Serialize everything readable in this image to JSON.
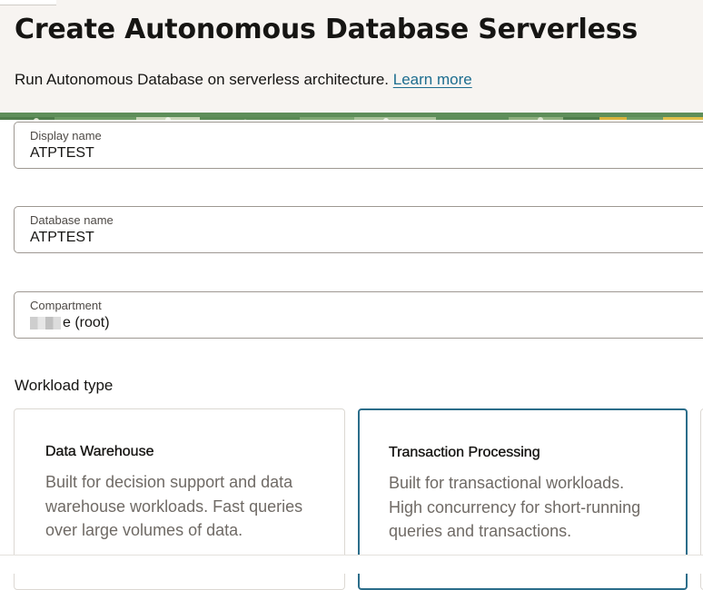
{
  "header": {
    "title": "Create Autonomous Database Serverless",
    "subtitle": "Run Autonomous Database on serverless architecture.",
    "learn_more": "Learn more"
  },
  "fields": {
    "display_name": {
      "label": "Display name",
      "value": "ATPTEST"
    },
    "database_name": {
      "label": "Database name",
      "value": "ATPTEST"
    },
    "compartment": {
      "label": "Compartment",
      "value_suffix": "e (root)"
    }
  },
  "workload": {
    "label": "Workload type",
    "options": [
      {
        "title": "Data Warehouse",
        "description": "Built for decision support and data warehouse workloads. Fast queries over large volumes of data.",
        "selected": false
      },
      {
        "title": "Transaction Processing",
        "description": "Built for transactional workloads. High concurrency for short-running queries and transactions.",
        "selected": true
      }
    ]
  },
  "colors": {
    "accent": "#2b6d8a",
    "link": "#1d6d8f",
    "header_bg": "#f7f4f1",
    "banner_green": "#5e8e5a"
  }
}
